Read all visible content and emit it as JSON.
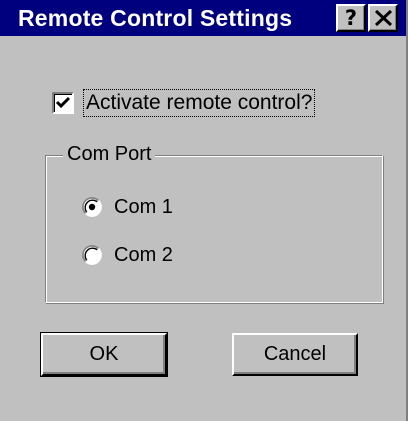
{
  "window": {
    "title": "Remote Control Settings",
    "title_bar_color": "#00007f",
    "body_color": "#c0c0c0"
  },
  "title_buttons": {
    "help_label": "?",
    "help_icon": "question-mark-icon",
    "close_icon": "x-close-icon"
  },
  "activate_checkbox": {
    "label": "Activate remote control?",
    "checked": true
  },
  "com_port_group": {
    "label": "Com Port",
    "options": [
      {
        "label": "Com 1",
        "selected": true
      },
      {
        "label": "Com 2",
        "selected": false
      }
    ]
  },
  "buttons": {
    "ok_label": "OK",
    "cancel_label": "Cancel"
  }
}
